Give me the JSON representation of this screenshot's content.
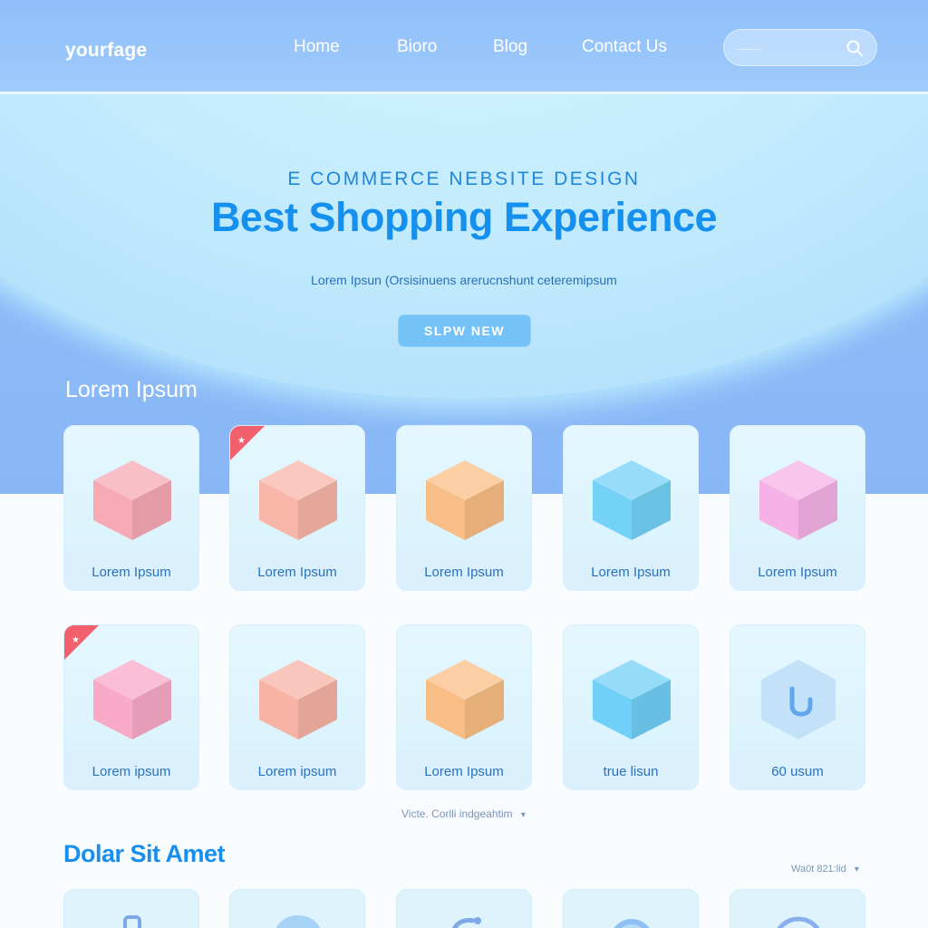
{
  "header": {
    "logo": "yourfage",
    "nav": [
      "Home",
      "Bioro",
      "Blog",
      "Contact Us"
    ],
    "search": {
      "placeholder": "——"
    }
  },
  "hero": {
    "eyebrow": "E COMMERCE NEBSITE DESIGN",
    "headline": "Best Shopping Experience",
    "subline": "Lorem  Ipsun (Orsisinuens arerucnshunt ceteremipsum",
    "cta": "SLPW NEW"
  },
  "products_section": {
    "title": "Lorem Ipsum",
    "row1": [
      {
        "label": "Lorem Ipsum",
        "color": "#f7a9b4",
        "badge": false,
        "icon": "cube-icon"
      },
      {
        "label": "Lorem Ipsum",
        "color": "#f8b6a8",
        "badge": true,
        "icon": "cube-icon"
      },
      {
        "label": "Lorem Ipsum",
        "color": "#f9bd86",
        "badge": false,
        "icon": "cube-icon"
      },
      {
        "label": "Lorem Ipsum",
        "color": "#74d2f7",
        "badge": false,
        "icon": "cube-icon"
      },
      {
        "label": "Lorem Ipsum",
        "color": "#f6b2e6",
        "badge": false,
        "icon": "cube-icon"
      }
    ],
    "row2": [
      {
        "label": "Lorem ipsum",
        "color": "#f8aac7",
        "badge": true,
        "icon": "cube-icon"
      },
      {
        "label": "Lorem ipsum",
        "color": "#f8b3a6",
        "badge": false,
        "icon": "cube-icon"
      },
      {
        "label": "Lorem Ipsum",
        "color": "#f9be85",
        "badge": false,
        "icon": "cube-icon"
      },
      {
        "label": "true lisun",
        "color": "#71d0f7",
        "badge": false,
        "icon": "cube-icon"
      },
      {
        "label": "60 usum",
        "color": "#a9d6f7",
        "badge": false,
        "icon": "hexagon-hook-icon"
      }
    ],
    "pager": "Victe. Corlli indgeahtim"
  },
  "section2": {
    "title": "Dolar Sit Amet",
    "sort": "Wa0t 821:lid",
    "icons": [
      "bag-icon",
      "cloud-icon",
      "refresh-icon",
      "globe-icon",
      "ring-icon"
    ]
  },
  "colors": {
    "accent": "#1590ee",
    "ribbon": "#f2606e",
    "cta": "#74c2f7"
  }
}
